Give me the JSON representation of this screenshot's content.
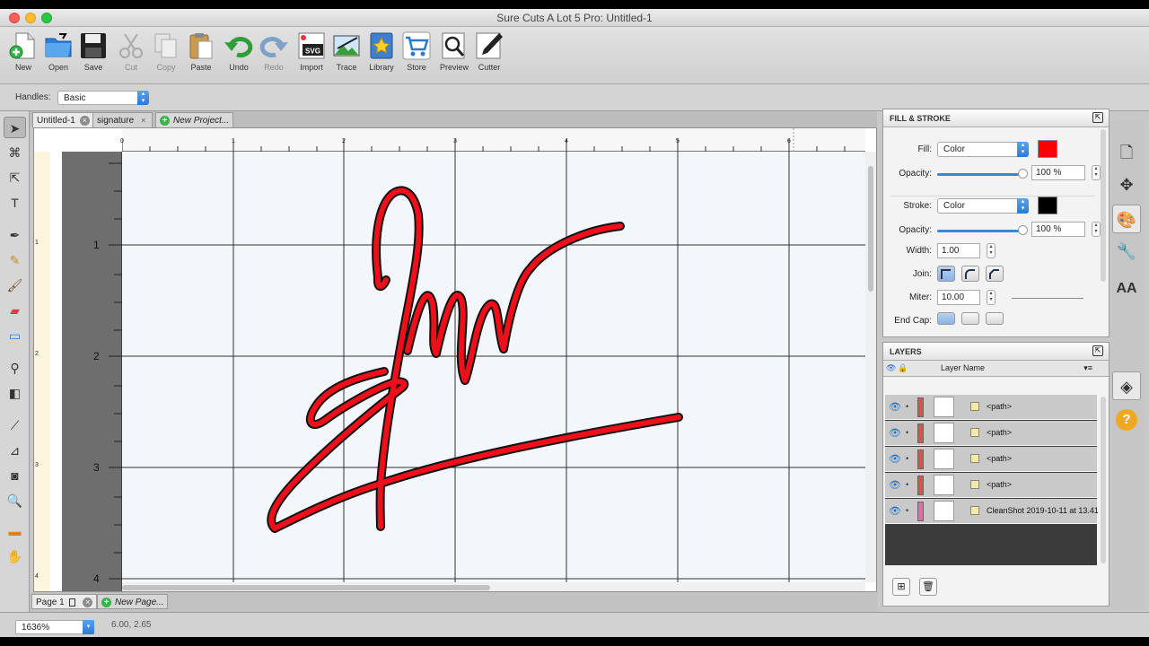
{
  "window": {
    "title": "Sure Cuts A Lot 5 Pro: Untitled-1"
  },
  "toolbar": {
    "new": "New",
    "open": "Open",
    "save": "Save",
    "cut": "Cut",
    "copy": "Copy",
    "paste": "Paste",
    "undo": "Undo",
    "redo": "Redo",
    "import": "Import",
    "trace": "Trace",
    "library": "Library",
    "store": "Store",
    "preview": "Preview",
    "cutter": "Cutter",
    "import_badge": "SVG"
  },
  "handles": {
    "label": "Handles:",
    "value": "Basic"
  },
  "doc_tabs": {
    "tab1": "Untitled-1",
    "tab2": "signature",
    "new_project": "New Project..."
  },
  "rulers": {
    "h": [
      "0",
      "1",
      "2",
      "3",
      "4",
      "5",
      "6"
    ],
    "v_small": [
      "1",
      "2",
      "3",
      "4"
    ],
    "v_big": [
      "1",
      "2",
      "3",
      "4"
    ]
  },
  "page_tabs": {
    "page1": "Page 1",
    "new_page": "New Page..."
  },
  "status": {
    "zoom": "1636%",
    "coords": "6.00, 2.65"
  },
  "fill_stroke": {
    "title": "FILL & STROKE",
    "fill_label": "Fill:",
    "fill_type": "Color",
    "fill_color": "#ff0000",
    "opacity_label": "Opacity:",
    "fill_opacity": "100 %",
    "stroke_label": "Stroke:",
    "stroke_type": "Color",
    "stroke_color": "#000000",
    "stroke_opacity": "100 %",
    "width_label": "Width:",
    "width": "1.00",
    "join_label": "Join:",
    "miter_label": "Miter:",
    "miter": "10.00",
    "endcap_label": "End Cap:"
  },
  "layers": {
    "title": "LAYERS",
    "col_name": "Layer Name",
    "rows": [
      {
        "name": "<path>",
        "color": "#d9534f"
      },
      {
        "name": "<path>",
        "color": "#d9534f"
      },
      {
        "name": "<path>",
        "color": "#d9534f"
      },
      {
        "name": "<path>",
        "color": "#d9534f"
      },
      {
        "name": "CleanShot 2019-10-11 at 13.41",
        "color": "#e46aa6"
      }
    ]
  },
  "colors": {
    "signature_fill": "#ee0f1a",
    "signature_stroke": "#111111",
    "accent": "#2e78d6"
  }
}
